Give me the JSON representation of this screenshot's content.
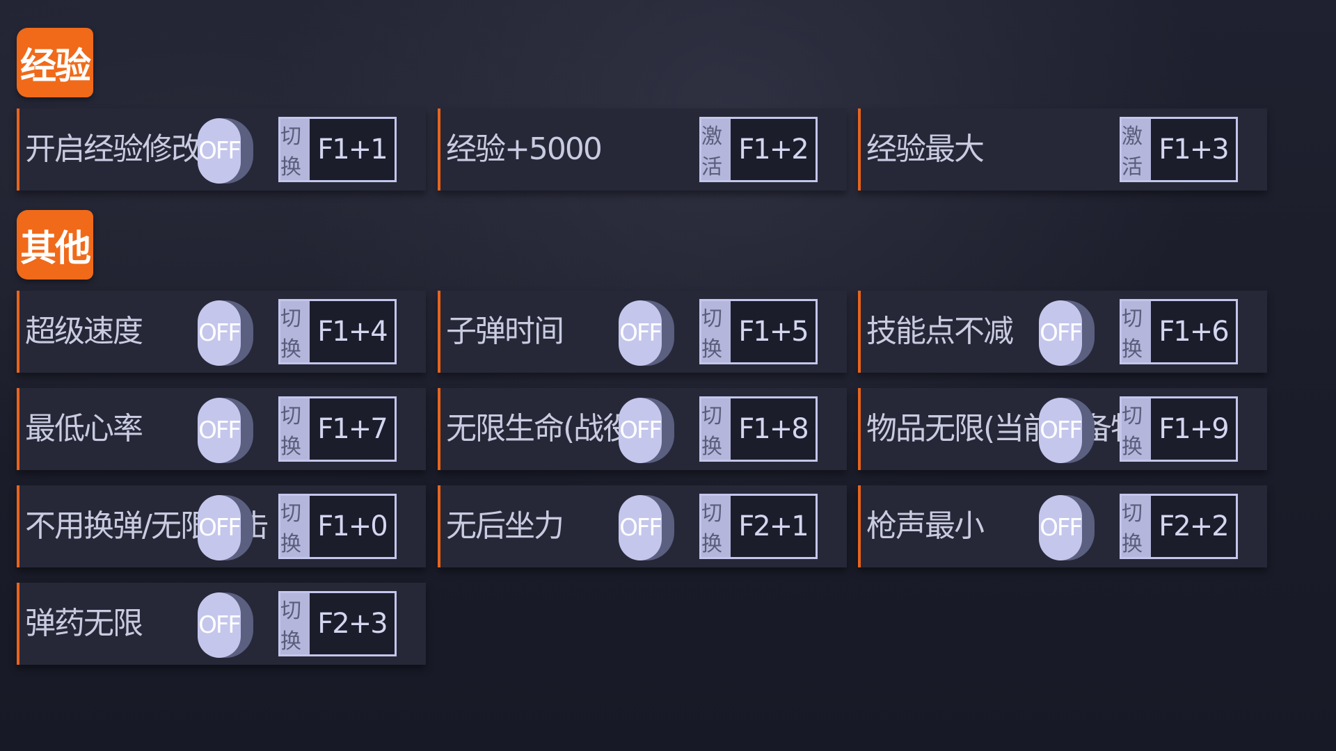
{
  "sections": [
    {
      "title": "经验",
      "items": [
        {
          "label": "开启经验修改",
          "toggle": "OFF",
          "mode": "切换",
          "key": "F1+1"
        },
        {
          "label": "经验+5000",
          "toggle": null,
          "mode": "激活",
          "key": "F1+2"
        },
        {
          "label": "经验最大",
          "toggle": null,
          "mode": "激活",
          "key": "F1+3"
        }
      ]
    },
    {
      "title": "其他",
      "items": [
        {
          "label": "超级速度",
          "toggle": "OFF",
          "mode": "切换",
          "key": "F1+4"
        },
        {
          "label": "子弹时间",
          "toggle": "OFF",
          "mode": "切换",
          "key": "F1+5"
        },
        {
          "label": "技能点不减",
          "toggle": "OFF",
          "mode": "切换",
          "key": "F1+6"
        },
        {
          "label": "最低心率",
          "toggle": "OFF",
          "mode": "切换",
          "key": "F1+7"
        },
        {
          "label": "无限生命(战役)",
          "toggle": "OFF",
          "mode": "切换",
          "key": "F1+8"
        },
        {
          "label": "物品无限(当前装备物品)",
          "toggle": "OFF",
          "mode": "切换",
          "key": "F1+9"
        },
        {
          "label": "不用换弹/无限射击",
          "toggle": "OFF",
          "mode": "切换",
          "key": "F1+0"
        },
        {
          "label": "无后坐力",
          "toggle": "OFF",
          "mode": "切换",
          "key": "F2+1"
        },
        {
          "label": "枪声最小",
          "toggle": "OFF",
          "mode": "切换",
          "key": "F2+2"
        },
        {
          "label": "弹药无限",
          "toggle": "OFF",
          "mode": "切换",
          "key": "F2+3"
        }
      ]
    }
  ],
  "colors": {
    "accent": "#f06a1a",
    "card_bg": "#262838",
    "toggle_off": "#c4c6ec",
    "background": "#191b28"
  }
}
